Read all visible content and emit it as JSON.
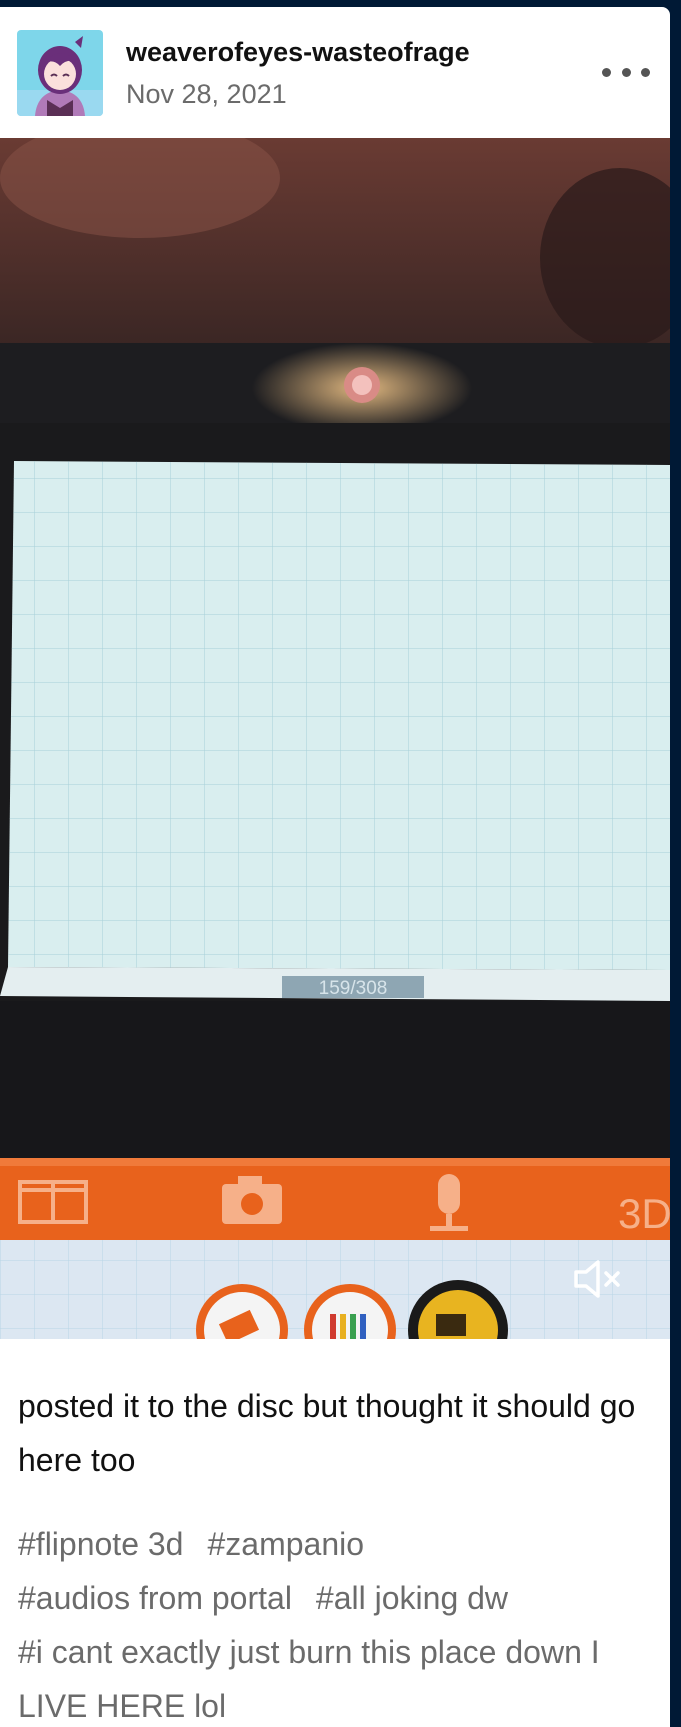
{
  "post": {
    "blog_name": "weaverofeyes-wasteofrage",
    "date": "Nov 28, 2021",
    "more_icon": "ellipsis-icon",
    "avatar": "avatar-image"
  },
  "video": {
    "frame_counter": "159/308",
    "mute_icon": "speaker-muted-icon",
    "toolbar_label_3d": "3D"
  },
  "body": {
    "caption": "posted it to the disc but thought it should go here too"
  },
  "tags": [
    "#flipnote 3d",
    "#zampanio",
    "#audios from portal",
    "#all joking dw",
    "#i cant exactly just burn this place down I LIVE HERE lol"
  ],
  "colors": {
    "page_bg": "#001935",
    "card_bg": "#ffffff",
    "muted_text": "#6b6b6b",
    "orange_toolbar": "#e8621c"
  }
}
